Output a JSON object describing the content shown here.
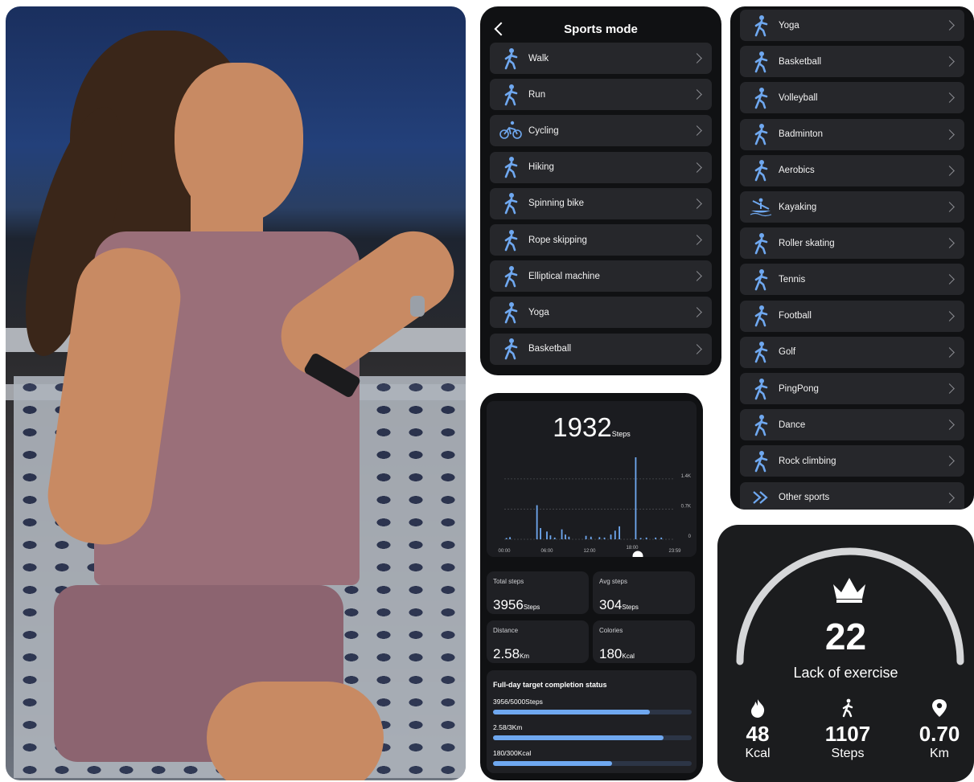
{
  "sports_mode": {
    "title": "Sports mode",
    "items_left": [
      {
        "label": "Walk",
        "icon": "walk-icon"
      },
      {
        "label": "Run",
        "icon": "run-icon"
      },
      {
        "label": "Cycling",
        "icon": "cycling-icon"
      },
      {
        "label": "Hiking",
        "icon": "hiking-icon"
      },
      {
        "label": "Spinning bike",
        "icon": "spinning-bike-icon"
      },
      {
        "label": "Rope skipping",
        "icon": "rope-skipping-icon"
      },
      {
        "label": "Elliptical machine",
        "icon": "elliptical-icon"
      },
      {
        "label": "Yoga",
        "icon": "yoga-icon"
      },
      {
        "label": "Basketball",
        "icon": "basketball-icon"
      }
    ],
    "items_right": [
      {
        "label": "Yoga",
        "icon": "yoga-icon"
      },
      {
        "label": "Basketball",
        "icon": "basketball-icon"
      },
      {
        "label": "Volleyball",
        "icon": "volleyball-icon"
      },
      {
        "label": "Badminton",
        "icon": "badminton-icon"
      },
      {
        "label": "Aerobics",
        "icon": "aerobics-icon"
      },
      {
        "label": "Kayaking",
        "icon": "kayaking-icon"
      },
      {
        "label": "Roller skating",
        "icon": "roller-skating-icon"
      },
      {
        "label": "Tennis",
        "icon": "tennis-icon"
      },
      {
        "label": "Football",
        "icon": "football-icon"
      },
      {
        "label": "Golf",
        "icon": "golf-icon"
      },
      {
        "label": "PingPong",
        "icon": "pingpong-icon"
      },
      {
        "label": "Dance",
        "icon": "dance-icon"
      },
      {
        "label": "Rock climbing",
        "icon": "rock-climbing-icon"
      },
      {
        "label": "Other sports",
        "icon": "other-sports-icon"
      }
    ]
  },
  "steps": {
    "count": "1932",
    "count_unit": "Steps",
    "cards": [
      {
        "title": "Total steps",
        "value": "3956",
        "unit": "Steps"
      },
      {
        "title": "Avg steps",
        "value": "304",
        "unit": "Steps"
      },
      {
        "title": "Distance",
        "value": "2.58",
        "unit": "Km"
      },
      {
        "title": "Colories",
        "value": "180",
        "unit": "Kcal"
      }
    ],
    "target": {
      "title": "Full-day target completion status",
      "rows": [
        {
          "label": "3956/5000Steps",
          "progress": 0.79
        },
        {
          "label": "2.58/3Km",
          "progress": 0.86
        },
        {
          "label": "180/300Kcal",
          "progress": 0.6
        }
      ]
    }
  },
  "chart_data": {
    "type": "bar",
    "x_tick_labels": [
      "00:00",
      "06:00",
      "12:00",
      "18:00",
      "23:59"
    ],
    "y_tick_labels": [
      "1.4K",
      "0.7K",
      "0"
    ],
    "ylim": [
      0,
      1900
    ],
    "grid": true,
    "x_hours": [
      0.3,
      0.8,
      4.6,
      5.1,
      6.0,
      6.5,
      7.1,
      8.1,
      8.6,
      9.1,
      11.5,
      12.2,
      13.4,
      14.1,
      15.0,
      15.6,
      16.2,
      18.5,
      19.2,
      20.0,
      21.3,
      22.1
    ],
    "values": [
      30,
      50,
      790,
      260,
      180,
      90,
      40,
      230,
      110,
      60,
      80,
      60,
      50,
      40,
      110,
      200,
      300,
      1900,
      30,
      40,
      40,
      40
    ],
    "selected_label": "18:00"
  },
  "exercise": {
    "score": "22",
    "status": "Lack of exercise",
    "stats": [
      {
        "value": "48",
        "unit": "Kcal",
        "icon": "flame-icon"
      },
      {
        "value": "1107",
        "unit": "Steps",
        "icon": "walk-icon"
      },
      {
        "value": "0.70",
        "unit": "Km",
        "icon": "location-pin-icon"
      }
    ]
  },
  "colors": {
    "accent": "#6fa8f0",
    "panel": "#101113",
    "item": "#26272b"
  }
}
